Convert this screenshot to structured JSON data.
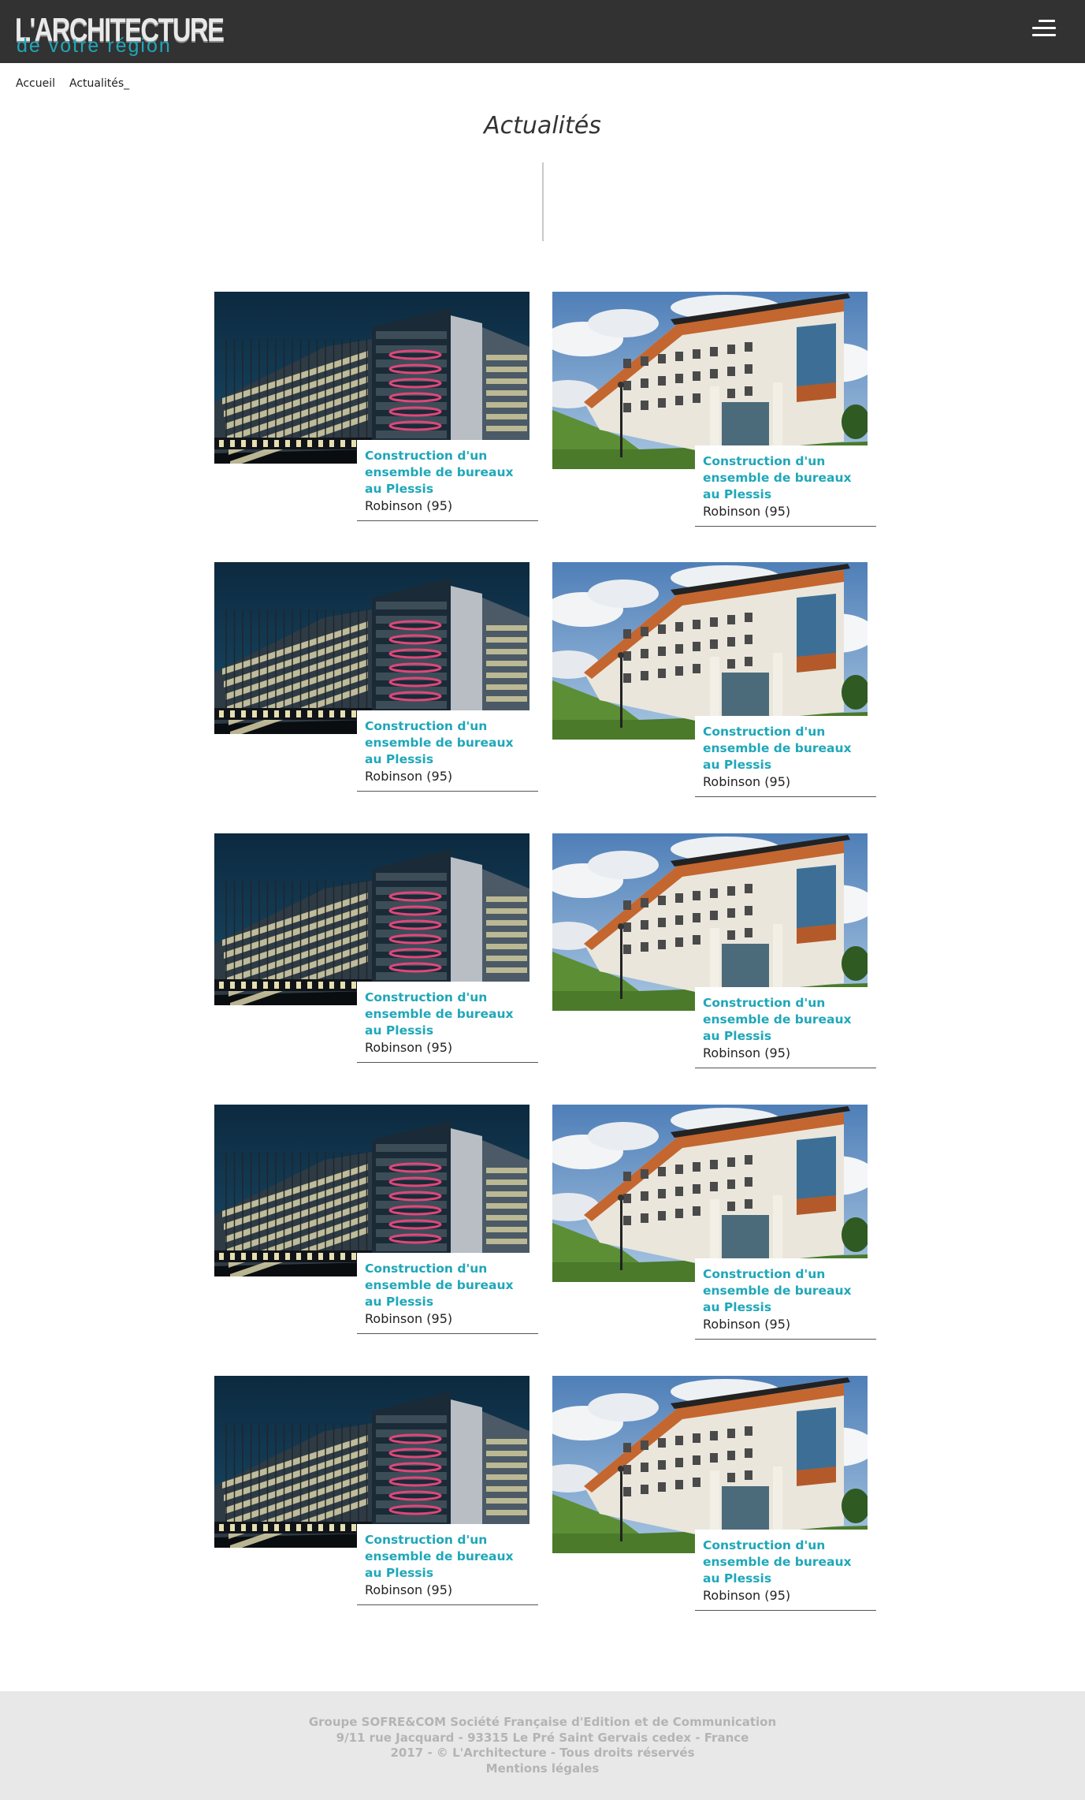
{
  "header": {
    "logo_main": "L'ARCHITECTURE",
    "logo_sub": "de votre région",
    "menu_icon": "hamburger-icon"
  },
  "breadcrumb": {
    "home": "Accueil",
    "current": "Actualités_"
  },
  "page": {
    "title": "Actualités"
  },
  "articles": [
    {
      "title": "Construction d'un ensemble de bureaux au Plessis",
      "subtitle": "Robinson (95)",
      "image": "office-night-photo"
    },
    {
      "title": "Construction d'un ensemble de bureaux au Plessis",
      "subtitle": "Robinson (95)",
      "image": "white-building-photo"
    },
    {
      "title": "Construction d'un ensemble de bureaux au Plessis",
      "subtitle": "Robinson (95)",
      "image": "office-night-photo"
    },
    {
      "title": "Construction d'un ensemble de bureaux au Plessis",
      "subtitle": "Robinson (95)",
      "image": "white-building-photo"
    },
    {
      "title": "Construction d'un ensemble de bureaux au Plessis",
      "subtitle": "Robinson (95)",
      "image": "office-night-photo"
    },
    {
      "title": "Construction d'un ensemble de bureaux au Plessis",
      "subtitle": "Robinson (95)",
      "image": "white-building-photo"
    },
    {
      "title": "Construction d'un ensemble de bureaux au Plessis",
      "subtitle": "Robinson (95)",
      "image": "office-night-photo"
    },
    {
      "title": "Construction d'un ensemble de bureaux au Plessis",
      "subtitle": "Robinson (95)",
      "image": "white-building-photo"
    },
    {
      "title": "Construction d'un ensemble de bureaux au Plessis",
      "subtitle": "Robinson (95)",
      "image": "office-night-photo"
    },
    {
      "title": "Construction d'un ensemble de bureaux au Plessis",
      "subtitle": "Robinson (95)",
      "image": "white-building-photo"
    }
  ],
  "footer": {
    "line1": "Groupe SOFRE&COM Société Française d'Edition et de Communication",
    "line2": "9/11 rue Jacquard - 93315 Le Pré Saint Gervais cedex - France",
    "line3": "2017 - © L'Architecture - Tous droits réservés",
    "legal_link": "Mentions légales"
  },
  "colors": {
    "header_bg": "#323232",
    "accent": "#1fa7b9",
    "footer_bg": "#e8e8e8",
    "footer_text": "#b4b4b4"
  }
}
